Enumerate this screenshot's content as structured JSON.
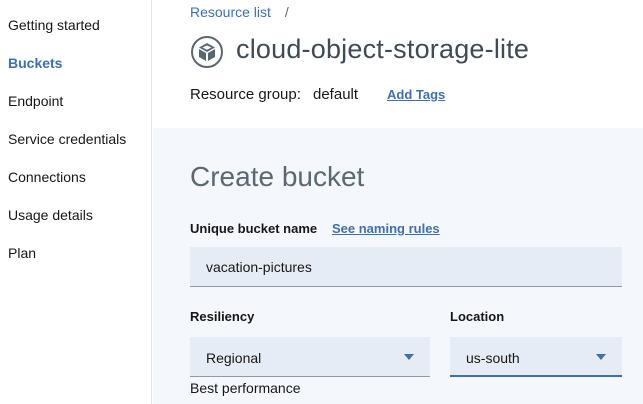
{
  "sidebar": {
    "items": [
      {
        "label": "Getting started",
        "active": false
      },
      {
        "label": "Buckets",
        "active": true
      },
      {
        "label": "Endpoint",
        "active": false
      },
      {
        "label": "Service credentials",
        "active": false
      },
      {
        "label": "Connections",
        "active": false
      },
      {
        "label": "Usage details",
        "active": false
      },
      {
        "label": "Plan",
        "active": false
      }
    ]
  },
  "header": {
    "breadcrumb": {
      "parent": "Resource list",
      "separator": "/"
    },
    "service_icon": "cube-storage-icon",
    "service_name": "cloud-object-storage-lite",
    "resource_group_label": "Resource group:",
    "resource_group_value": "default",
    "add_tags_label": "Add Tags"
  },
  "form": {
    "title": "Create bucket",
    "bucket_name_label": "Unique bucket name",
    "naming_rules_link": "See naming rules",
    "bucket_name_value": "vacation-pictures",
    "resiliency_label": "Resiliency",
    "resiliency_value": "Regional",
    "resiliency_helper": "Best performance",
    "location_label": "Location",
    "location_value": "us-south"
  },
  "colors": {
    "accent": "#3d70b2",
    "field_background": "#e6ecf5",
    "main_background": "#f4f7fb"
  }
}
